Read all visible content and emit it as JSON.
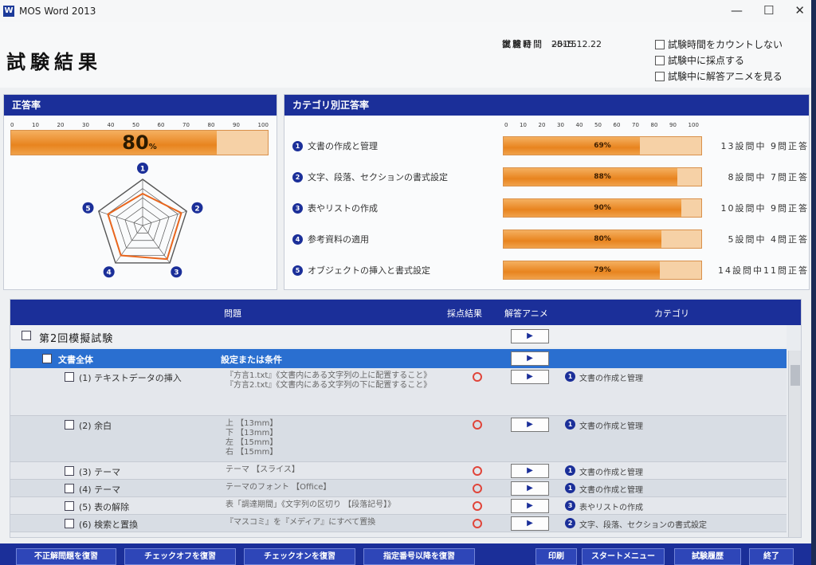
{
  "window": {
    "title": "MOS Word 2013",
    "app_icon": "W"
  },
  "header": {
    "title": "試験結果",
    "info": [
      {
        "label": "実施日",
        "value": "2015.12.22"
      },
      {
        "label": "試験時間",
        "value": "25:15"
      },
      {
        "label": "復習時間",
        "value": "--:--"
      }
    ],
    "options": [
      "試験時間をカウントしない",
      "試験中に採点する",
      "試験中に解答アニメを見る"
    ]
  },
  "score_panel": {
    "title": "正答率",
    "scale": [
      "0",
      "10",
      "20",
      "30",
      "40",
      "50",
      "60",
      "70",
      "80",
      "90",
      "100"
    ],
    "value": "80",
    "unit": "%",
    "percent": 80,
    "radar_labels": [
      "1",
      "2",
      "3",
      "4",
      "5"
    ],
    "radar_values": [
      0.69,
      0.88,
      0.9,
      0.8,
      0.79
    ]
  },
  "category_panel": {
    "title": "カテゴリ別正答率",
    "scale": [
      "0",
      "10",
      "20",
      "30",
      "40",
      "50",
      "60",
      "70",
      "80",
      "90",
      "100"
    ],
    "items": [
      {
        "num": "1",
        "name": "文書の作成と管理",
        "rate": "69%",
        "percent": 69,
        "count": "13設問中 9問正答"
      },
      {
        "num": "2",
        "name": "文字、段落、セクションの書式設定",
        "rate": "88%",
        "percent": 88,
        "count": "8設問中 7問正答"
      },
      {
        "num": "3",
        "name": "表やリストの作成",
        "rate": "90%",
        "percent": 90,
        "count": "10設問中 9問正答"
      },
      {
        "num": "4",
        "name": "参考資料の適用",
        "rate": "80%",
        "percent": 80,
        "count": "5設問中 4問正答"
      },
      {
        "num": "5",
        "name": "オブジェクトの挿入と書式設定",
        "rate": "79%",
        "percent": 79,
        "count": "14設問中11問正答"
      }
    ]
  },
  "table": {
    "headers": {
      "question": "問題",
      "result": "採点結果",
      "anime": "解答アニメ",
      "category": "カテゴリ"
    },
    "exam_title": "第2回模擬試験",
    "group": {
      "name": "文書全体",
      "condition_header": "設定または条件"
    },
    "rows": [
      {
        "name": "(1) テキストデータの挿入",
        "cond": "『方言1.txt』《文書内にある文字列の上に配置すること》\n『方言2.txt』《文書内にある文字列の下に配置すること》",
        "category": "文書の作成と管理",
        "cat_num": "1"
      },
      {
        "name": "(2) 余白",
        "cond": "上 【13mm】\n下 【13mm】\n左 【15mm】\n右 【15mm】",
        "category": "文書の作成と管理",
        "cat_num": "1"
      },
      {
        "name": "(3) テーマ",
        "cond": "テーマ 【スライス】",
        "category": "文書の作成と管理",
        "cat_num": "1"
      },
      {
        "name": "(4) テーマ",
        "cond": "テーマのフォント 【Office】",
        "category": "文書の作成と管理",
        "cat_num": "1"
      },
      {
        "name": "(5) 表の解除",
        "cond": "表「調達期間」《文字列の区切り 【段落記号】》",
        "category": "表やリストの作成",
        "cat_num": "3"
      },
      {
        "name": "(6) 検索と置換",
        "cond": "『マスコミ』を『メディア』にすべて置換",
        "category": "文字、段落、セクションの書式設定",
        "cat_num": "2"
      }
    ],
    "play_glyph": "▶"
  },
  "buttons": [
    "不正解問題を復習",
    "チェックオフを復習",
    "チェックオンを復習",
    "指定番号以降を復習",
    "印刷",
    "スタートメニュー",
    "試験履歴",
    "終了"
  ]
}
